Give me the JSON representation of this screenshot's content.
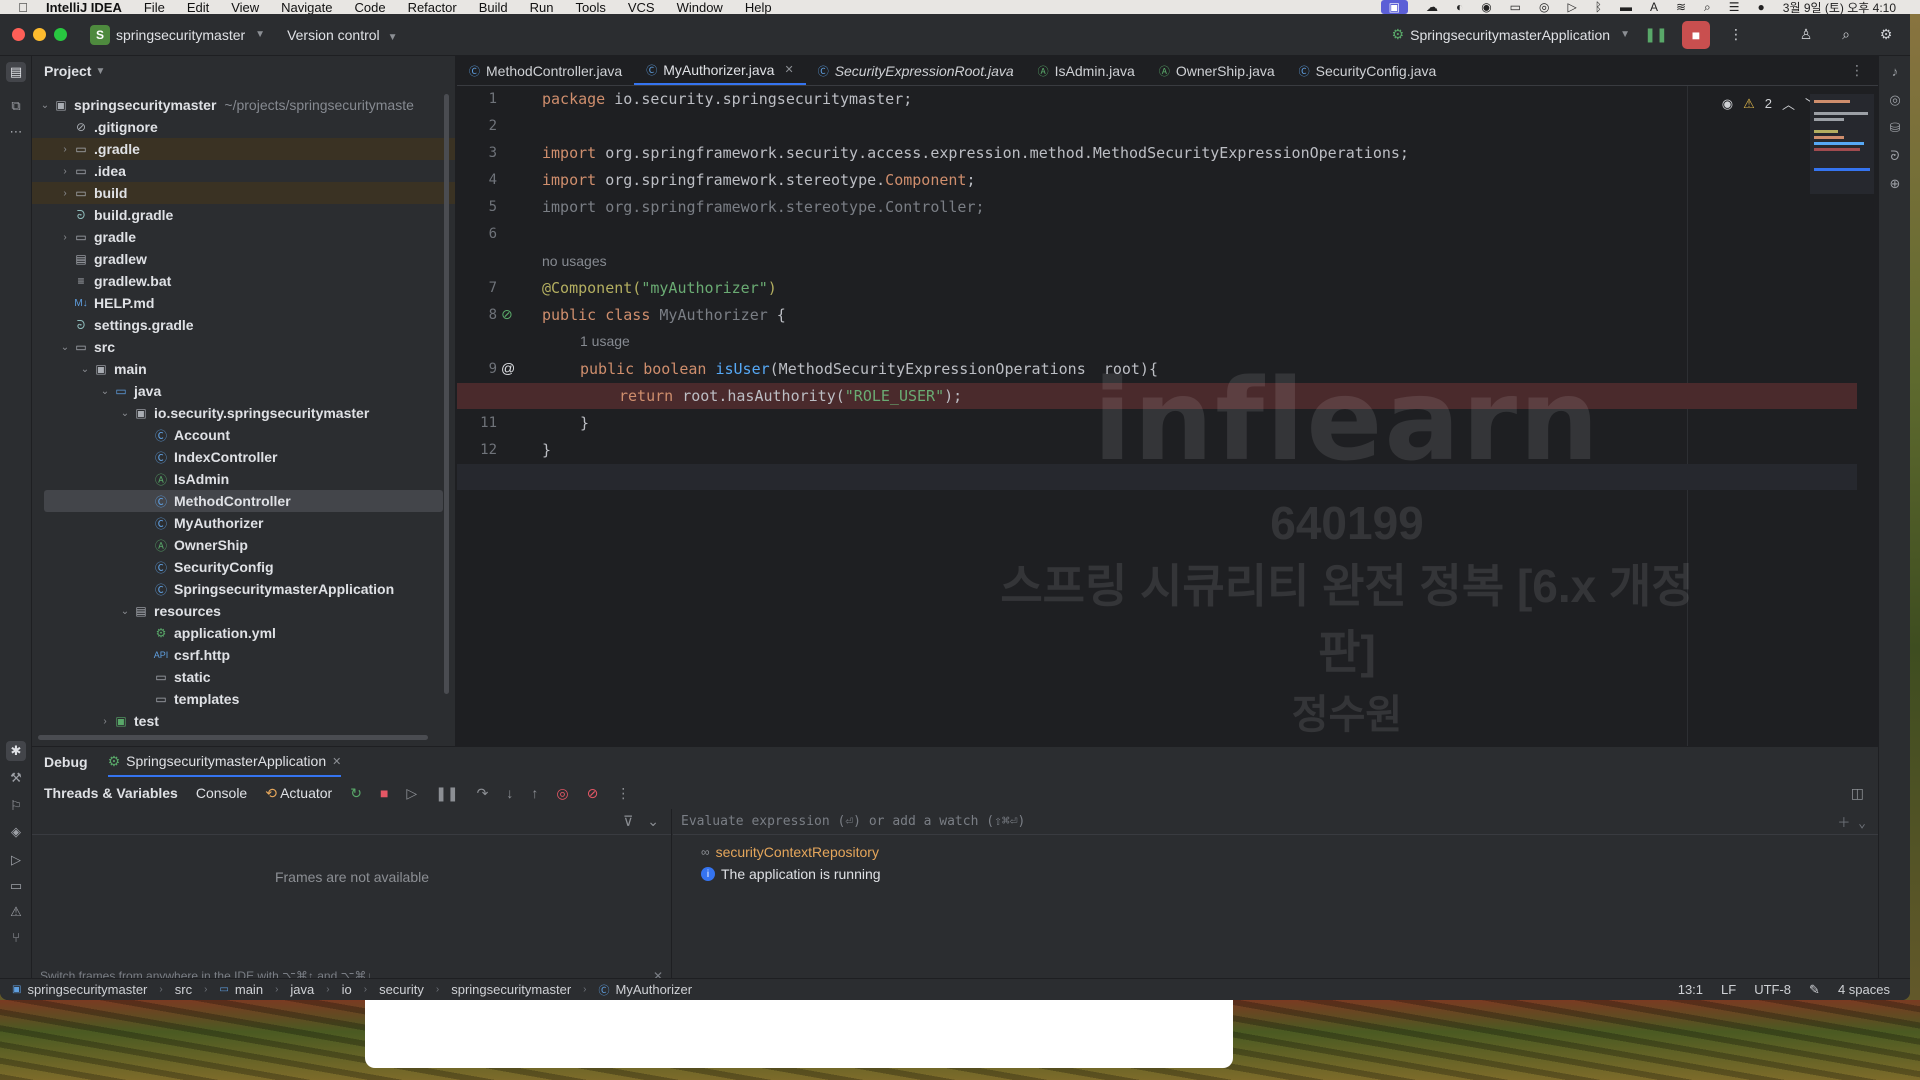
{
  "menubar": {
    "app_name": "IntelliJ IDEA",
    "items": [
      "File",
      "Edit",
      "View",
      "Navigate",
      "Code",
      "Refactor",
      "Build",
      "Run",
      "Tools",
      "VCS",
      "Window",
      "Help"
    ],
    "clock": "3월 9일 (토) 오후 4:10"
  },
  "titlebar": {
    "project_badge": "S",
    "project_name": "springsecuritymaster",
    "vcs_label": "Version control",
    "run_config": "SpringsecuritymasterApplication"
  },
  "project_panel": {
    "title": "Project",
    "tree": [
      {
        "label": "springsecuritymaster",
        "hint": "~/projects/springsecuritymaste",
        "icon": "module-icon"
      },
      {
        "label": ".gitignore",
        "icon": "ignore-file-icon"
      },
      {
        "label": ".gradle",
        "icon": "folder-icon"
      },
      {
        "label": ".idea",
        "icon": "folder-icon"
      },
      {
        "label": "build",
        "icon": "folder-icon"
      },
      {
        "label": "build.gradle",
        "icon": "gradle-icon"
      },
      {
        "label": "gradle",
        "icon": "folder-icon"
      },
      {
        "label": "gradlew",
        "icon": "script-icon"
      },
      {
        "label": "gradlew.bat",
        "icon": "text-file-icon"
      },
      {
        "label": "HELP.md",
        "icon": "markdown-icon"
      },
      {
        "label": "settings.gradle",
        "icon": "gradle-icon"
      },
      {
        "label": "src",
        "icon": "folder-icon"
      },
      {
        "label": "main",
        "icon": "folder-icon"
      },
      {
        "label": "java",
        "icon": "source-folder-icon"
      },
      {
        "label": "io.security.springsecuritymaster",
        "icon": "package-icon"
      },
      {
        "label": "Account",
        "icon": "class-icon"
      },
      {
        "label": "IndexController",
        "icon": "class-icon"
      },
      {
        "label": "IsAdmin",
        "icon": "annotation-icon"
      },
      {
        "label": "MethodController",
        "icon": "class-icon"
      },
      {
        "label": "MyAuthorizer",
        "icon": "class-icon"
      },
      {
        "label": "OwnerShip",
        "icon": "annotation-icon"
      },
      {
        "label": "SecurityConfig",
        "icon": "class-icon"
      },
      {
        "label": "SpringsecuritymasterApplication",
        "icon": "class-icon"
      },
      {
        "label": "resources",
        "icon": "resources-folder-icon"
      },
      {
        "label": "application.yml",
        "icon": "yaml-icon"
      },
      {
        "label": "csrf.http",
        "icon": "http-file-icon"
      },
      {
        "label": "static",
        "icon": "folder-icon"
      },
      {
        "label": "templates",
        "icon": "folder-icon"
      },
      {
        "label": "test",
        "icon": "test-folder-icon"
      }
    ]
  },
  "editor": {
    "tabs": [
      "MethodController.java",
      "MyAuthorizer.java",
      "SecurityExpressionRoot.java",
      "IsAdmin.java",
      "OwnerShip.java",
      "SecurityConfig.java"
    ],
    "active_tab": "MyAuthorizer.java",
    "warning_count": "2",
    "line_numbers": [
      "1",
      "2",
      "3",
      "4",
      "5",
      "6",
      "7",
      "8",
      "9",
      "11",
      "12",
      "13"
    ],
    "hints": [
      "no usages",
      "1 usage"
    ],
    "code": {
      "l1_kw": "package",
      "l1_rest": " io.security.springsecuritymaster;",
      "l3_kw": "import",
      "l3_rest": " org.springframework.security.access.expression.method.MethodSecurityExpressionOperations;",
      "l4_kw": "import",
      "l4_rest": " org.springframework.stereotype.",
      "l4_cls": "Component",
      "l4_end": ";",
      "l5_full": "import org.springframework.stereotype.Controller;",
      "l7_ann": "@Component(",
      "l7_str": "\"myAuthorizer\"",
      "l7_end": ")",
      "l8_kw": "public class",
      "l8_cls": " MyAuthorizer",
      "l8_end": " {",
      "l9_kw": "public boolean",
      "l9_fn": " isUser",
      "l9_rest": "(MethodSecurityExpressionOperations  root){",
      "l10_kw": "return",
      "l10_rest": " root.hasAuthority(",
      "l10_str": "\"ROLE_USER\"",
      "l10_end": ");",
      "l11": "}",
      "l12": "}"
    },
    "watermark": {
      "logo": "inflearn",
      "id": "640199",
      "course": "스프링 시큐리티 완전 정복 [6.x 개정판]",
      "name": "정수원"
    }
  },
  "debug": {
    "title": "Debug",
    "session": "SpringsecuritymasterApplication",
    "tabs": [
      "Threads & Variables",
      "Console",
      "Actuator"
    ],
    "frames_empty": "Frames are not available",
    "frames_hint": "Switch frames from anywhere in the IDE with ⌥⌘↑ and ⌥⌘↓",
    "eval_placeholder": "Evaluate expression (⏎) or add a watch (⇧⌘⏎)",
    "variable": "securityContextRepository",
    "message": "The application is running"
  },
  "statusbar": {
    "breadcrumbs": [
      "springsecuritymaster",
      "src",
      "main",
      "java",
      "io",
      "security",
      "springsecuritymaster",
      "MyAuthorizer"
    ],
    "position": "13:1",
    "line_sep": "LF",
    "encoding": "UTF-8",
    "indent": "4 spaces"
  },
  "colors": {
    "accent": "#3574f0",
    "breakpoint": "#e55765",
    "debug_run": "#499c54",
    "stop": "#c94f4f"
  }
}
